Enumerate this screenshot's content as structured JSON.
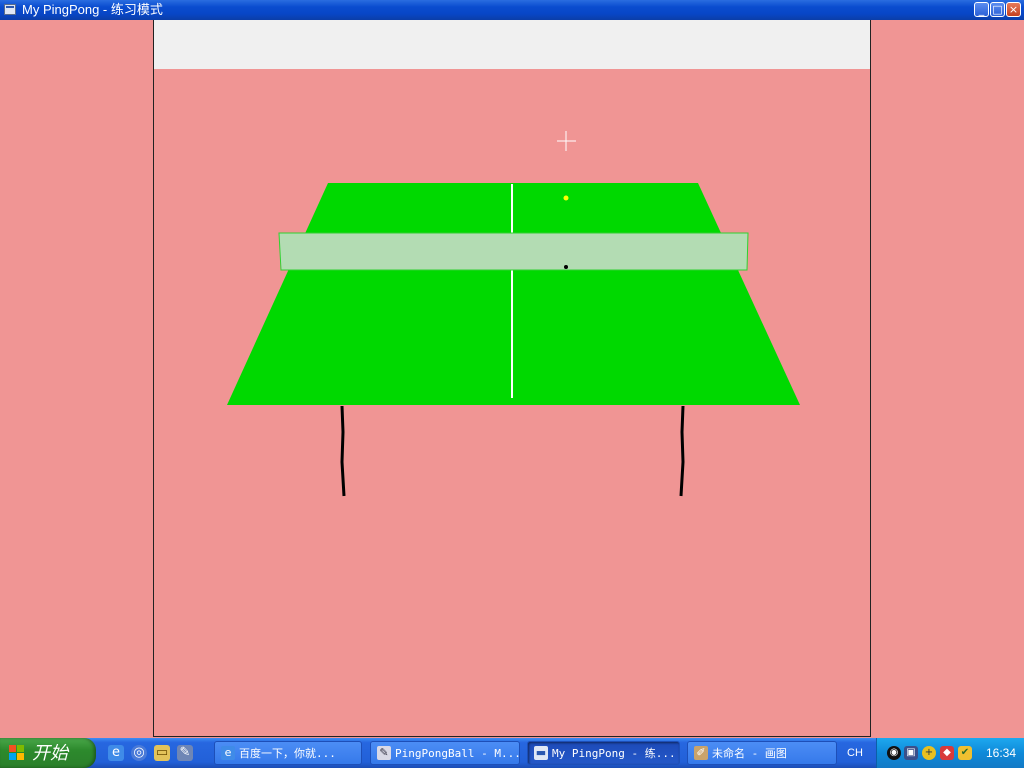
{
  "window": {
    "title": "My PingPong - 练习模式"
  },
  "colors": {
    "background": "#f09594",
    "table": "#00d900",
    "net": "#b3dcb3",
    "centerline": "#ffffff",
    "ball": "#ffff00",
    "legs": "#000000"
  },
  "taskbar": {
    "start_label": "开始",
    "quick_launch": [
      "ie-icon",
      "browser-icon",
      "folder-icon",
      "tool-icon"
    ],
    "tasks": [
      {
        "label": "百度一下，你就...",
        "icon": "ie-icon"
      },
      {
        "label": "PingPongBall - M...",
        "icon": "project-icon"
      },
      {
        "label": "My PingPong - 练...",
        "icon": "app-window-icon"
      },
      {
        "label": "未命名 - 画图",
        "icon": "paint-icon"
      }
    ],
    "language": "CH",
    "tray_icons": [
      "network-icon",
      "display-icon",
      "shield-plus-icon",
      "antivirus-icon",
      "security-icon"
    ],
    "clock": "16:34"
  }
}
